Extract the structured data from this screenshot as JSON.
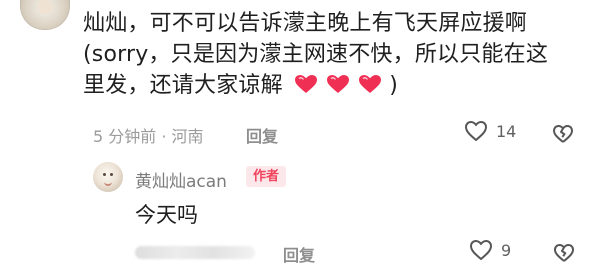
{
  "comment": {
    "line1": "灿灿，可不可以告诉濛主晚上有飞天屏应援啊",
    "line2": "(sorry，只是因为濛主网速不快，所以只能在这",
    "line3_prefix": "里发，还请大家谅解",
    "line3_suffix": ")",
    "time_location": "5 分钟前 · 河南",
    "reply_label": "回复",
    "like_count": "14"
  },
  "reply": {
    "author": "黄灿灿acan",
    "badge": "作者",
    "text": "今天吗",
    "reply_label": "回复",
    "like_count": "9"
  },
  "colors": {
    "heart": "#f02f55",
    "meta": "#9b9b9b",
    "badge_bg": "#fce8eb",
    "badge_text": "#f0435c"
  },
  "icons": {
    "heart": "heart-icon",
    "like": "like-outline-icon",
    "dislike": "broken-heart-icon"
  }
}
